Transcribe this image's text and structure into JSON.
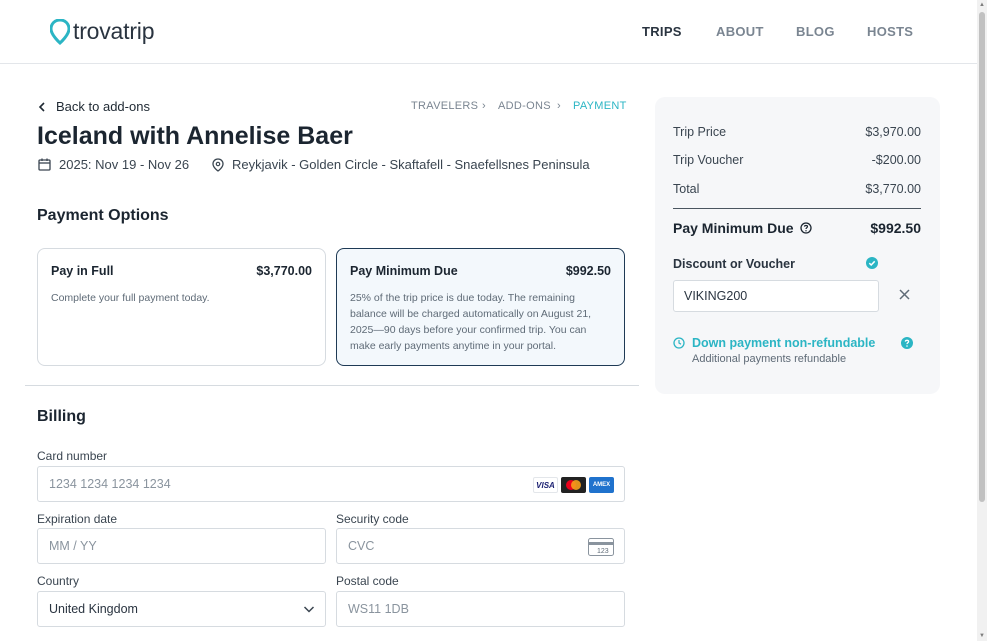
{
  "brand": {
    "name": "trovatrip",
    "accent": "#2bb5c4"
  },
  "nav": [
    {
      "label": "TRIPS",
      "active": true
    },
    {
      "label": "ABOUT",
      "active": false
    },
    {
      "label": "BLOG",
      "active": false
    },
    {
      "label": "HOSTS",
      "active": false
    }
  ],
  "back_label": "Back to add-ons",
  "breadcrumb": [
    {
      "label": "TRAVELERS"
    },
    {
      "label": "ADD-ONS"
    },
    {
      "label": "PAYMENT",
      "current": true
    }
  ],
  "trip": {
    "title": "Iceland with Annelise Baer",
    "dates": "2025: Nov 19 - Nov 26",
    "route": "Reykjavik - Golden Circle - Skaftafell - Snaefellsnes Peninsula"
  },
  "payment_options": {
    "title": "Payment Options",
    "full": {
      "label": "Pay in Full",
      "amount": "$3,770.00",
      "description": "Complete your full payment today."
    },
    "minimum": {
      "label": "Pay Minimum Due",
      "amount": "$992.50",
      "description": "25% of the trip price is due today. The remaining balance will be charged automatically on August 21, 2025—90 days before your confirmed trip. You can make early payments anytime in your portal.",
      "selected": true
    }
  },
  "billing": {
    "title": "Billing",
    "card_number": {
      "label": "Card number",
      "placeholder": "1234 1234 1234 1234"
    },
    "card_brands": [
      "VISA",
      "mastercard",
      "AMEX"
    ],
    "expiration": {
      "label": "Expiration date",
      "placeholder": "MM / YY"
    },
    "security": {
      "label": "Security code",
      "placeholder": "CVC",
      "icon_text": "123"
    },
    "country": {
      "label": "Country",
      "value": "United Kingdom"
    },
    "postal": {
      "label": "Postal code",
      "placeholder": "WS11 1DB"
    }
  },
  "summary": {
    "trip_price": {
      "label": "Trip Price",
      "value": "$3,970.00"
    },
    "voucher": {
      "label": "Trip Voucher",
      "value": "-$200.00"
    },
    "total": {
      "label": "Total",
      "value": "$3,770.00"
    },
    "minimum_due": {
      "label": "Pay Minimum Due",
      "value": "$992.50"
    },
    "discount_label": "Discount or Voucher",
    "discount_code": "VIKING200",
    "notice_title": "Down payment non-refundable",
    "notice_sub": "Additional payments refundable"
  }
}
